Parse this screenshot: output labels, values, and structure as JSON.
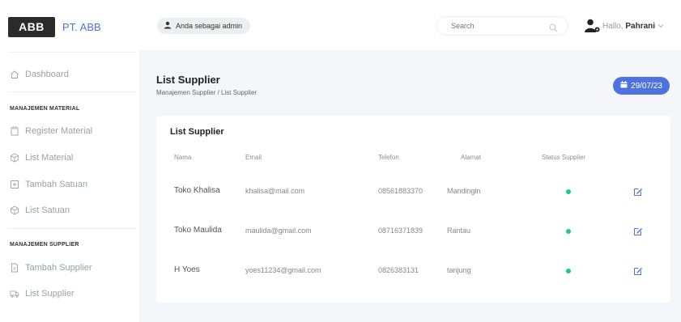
{
  "brand": {
    "logo_text": "ABB",
    "name": "PT. ABB"
  },
  "sidebar": {
    "dashboard": "Dashboard",
    "section_material": "MANAJEMEN MATERIAL",
    "material_items": [
      {
        "label": "Register Material",
        "icon": "clipboard-icon"
      },
      {
        "label": "List Material",
        "icon": "cube-icon"
      },
      {
        "label": "Tambah Satuan",
        "icon": "plus-square-icon"
      },
      {
        "label": "List Satuan",
        "icon": "cube-icon"
      }
    ],
    "section_supplier": "MANAJEMEN SUPPLIER",
    "supplier_items": [
      {
        "label": "Tambah Supplier",
        "icon": "document-icon"
      },
      {
        "label": "List Supplier",
        "icon": "truck-icon"
      }
    ]
  },
  "topbar": {
    "role_badge": "Anda sebagai admin",
    "search_placeholder": "Search",
    "hello_prefix": "Hallo,",
    "user_name": "Pahrani"
  },
  "page": {
    "title": "List Supplier",
    "breadcrumb": "Manajemen Supplier / List Supplier",
    "date": "29/07/23"
  },
  "card": {
    "title": "List Supplier",
    "columns": [
      "Nama",
      "Email",
      "Telefon",
      "Alamat",
      "Status Supplier"
    ],
    "rows": [
      {
        "nama": "Toko Khalisa",
        "email": "khalisa@mail.com",
        "telefon": "08561883370",
        "alamat": "Mandingin",
        "status": "active"
      },
      {
        "nama": "Toko Maulida",
        "email": "maulida@gmail.com",
        "telefon": "08716371839",
        "alamat": "Rantau",
        "status": "active"
      },
      {
        "nama": "H Yoes",
        "email": "yoes11234@gmail.com",
        "telefon": "0826383131",
        "alamat": "tanjung",
        "status": "active"
      }
    ]
  },
  "colors": {
    "accent": "#4e73df",
    "status_active": "#1cc88a"
  }
}
